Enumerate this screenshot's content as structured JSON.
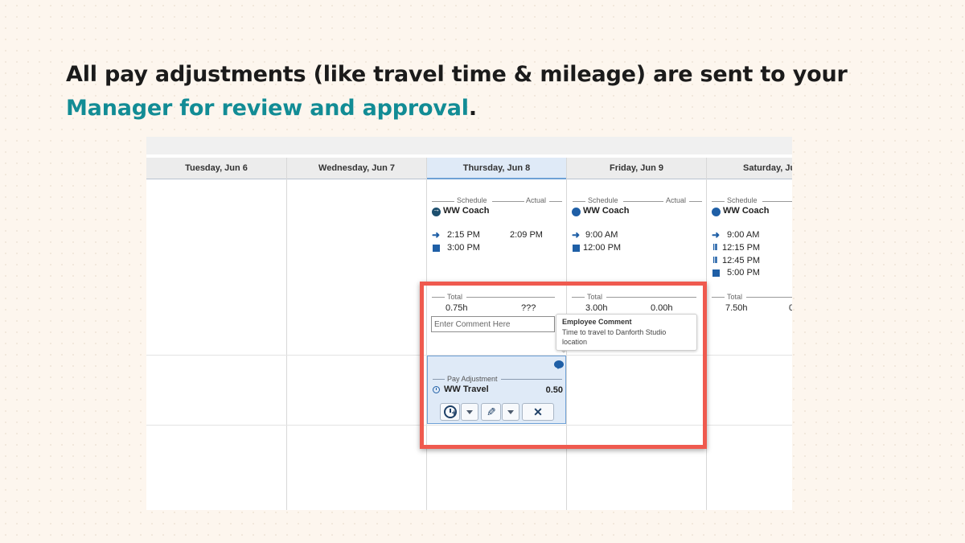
{
  "headline": {
    "text": "All pay adjustments (like travel time & mileage) are sent to your ",
    "accent": "Manager for review and approval",
    "end": "."
  },
  "colors": {
    "accent": "#128c95",
    "highlight": "#ef5a4f",
    "primary": "#1f5fa6"
  },
  "calendar": {
    "columns": [
      {
        "label": "Tuesday, Jun 6"
      },
      {
        "label": "Wednesday, Jun 7"
      },
      {
        "label": "Thursday, Jun 8",
        "active": true
      },
      {
        "label": "Friday, Jun 9"
      },
      {
        "label": "Saturday, Ju"
      }
    ],
    "thursday": {
      "schedule_label": "Schedule",
      "actual_label": "Actual",
      "shift": "WW Coach",
      "start": "2:15 PM",
      "actual_start": "2:09 PM",
      "end": "3:00 PM",
      "total_label": "Total",
      "total": "0.75h",
      "actual_total": "???"
    },
    "friday": {
      "schedule_label": "Schedule",
      "actual_label": "Actual",
      "shift": "WW Coach",
      "start": "9:00 AM",
      "end": "12:00 PM",
      "total_label": "Total",
      "total": "3.00h",
      "actual_total": "0.00h"
    },
    "saturday": {
      "schedule_label": "Schedule",
      "shift": "WW Coach",
      "start": "9:00 AM",
      "meal_start": "12:15 PM",
      "meal_end": "12:45 PM",
      "end": "5:00 PM",
      "total_label": "Total",
      "total": "7.50h",
      "actual_total_partial": "0"
    },
    "comment": {
      "placeholder": "Enter Comment Here",
      "tooltip_title": "Employee Comment",
      "tooltip_body": "Time to travel to Danforth Studio location"
    },
    "pay_adjustment": {
      "label": "Pay Adjustment",
      "name": "WW Travel",
      "value": "0.50"
    }
  },
  "icons": [
    "comment-bubble-icon",
    "clock-plus-icon",
    "pencil-icon",
    "close-icon",
    "chevron-down-icon",
    "arrow-right-icon",
    "stop-icon",
    "meal-icon",
    "clock-icon"
  ]
}
